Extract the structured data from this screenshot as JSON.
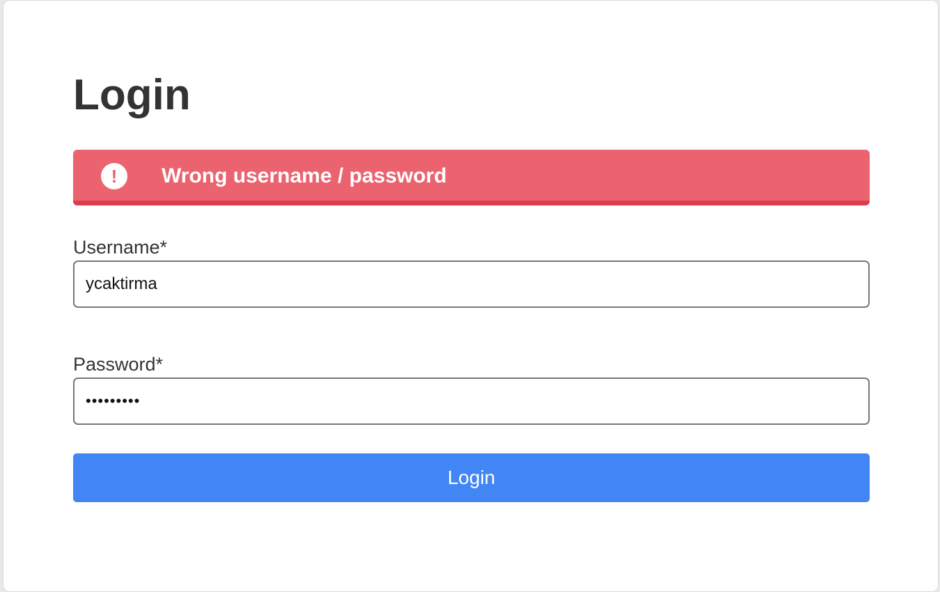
{
  "page": {
    "title": "Login"
  },
  "alert": {
    "icon": "exclamation-circle-icon",
    "icon_glyph": "!",
    "message": "Wrong username / password",
    "color": "#ea636f",
    "accent_color": "#e23a4b"
  },
  "form": {
    "username": {
      "label": "Username*",
      "value": "ycaktirma"
    },
    "password": {
      "label": "Password*",
      "value": "•••••••••"
    },
    "submit_label": "Login",
    "submit_color": "#4285f4"
  }
}
